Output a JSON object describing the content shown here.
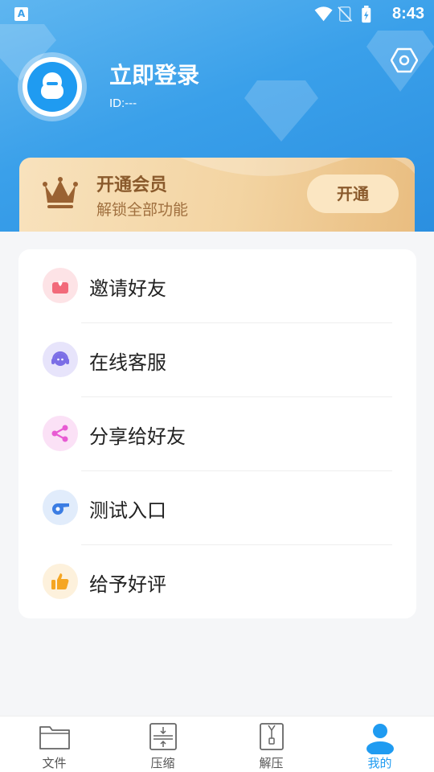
{
  "status_bar": {
    "time": "8:43",
    "left_icon": "A"
  },
  "profile": {
    "title": "立即登录",
    "id_text": "ID:---"
  },
  "vip": {
    "title": "开通会员",
    "subtitle": "解锁全部功能",
    "button": "开通"
  },
  "menu": [
    {
      "label": "邀请好友",
      "icon": "gift-icon",
      "color": "#f26a7a",
      "bg": "#fde3e6"
    },
    {
      "label": "在线客服",
      "icon": "headset-icon",
      "color": "#7b6ee6",
      "bg": "#e7e4fb"
    },
    {
      "label": "分享给好友",
      "icon": "share-icon",
      "color": "#e85bd3",
      "bg": "#fbe1f6"
    },
    {
      "label": "测试入口",
      "icon": "whistle-icon",
      "color": "#3b7de3",
      "bg": "#e1ecfb"
    },
    {
      "label": "给予好评",
      "icon": "thumbs-up-icon",
      "color": "#f5a623",
      "bg": "#fdf1dc"
    }
  ],
  "tabs": [
    {
      "label": "文件",
      "icon": "folder-icon"
    },
    {
      "label": "压缩",
      "icon": "compress-icon"
    },
    {
      "label": "解压",
      "icon": "zip-file-icon"
    },
    {
      "label": "我的",
      "icon": "user-icon",
      "active": true
    }
  ],
  "colors": {
    "accent": "#1f9bf1",
    "vip_text": "#8a5a2c"
  }
}
